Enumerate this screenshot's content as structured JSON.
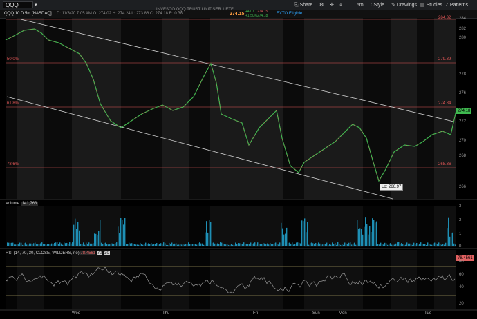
{
  "toolbar": {
    "symbol": "QQQ",
    "share": "Share",
    "interval": "5m",
    "style": "Style",
    "drawings": "Drawings",
    "studies": "Studies",
    "patterns": "Patterns"
  },
  "info": {
    "chart_id": "QQQ 10 D 5m [NASDAQ]",
    "name": "INVESCO QQQ TRUST UNIT SER 1 ETF",
    "last": "274.15",
    "change_top": "+4.07",
    "change_bottom": "+1.50%",
    "bid": "274.15",
    "ask": "274.18",
    "ext": "EXTO Eligible",
    "ohlc": "D: 11/3/20 7:05 AM   O: 274.02   H: 274.24   L: 273.86   C: 274.18   R: 0.38"
  },
  "price_panel": {
    "ylim": [
      265,
      285
    ],
    "ticks": [
      "284",
      "282",
      "280",
      "278",
      "276",
      "274",
      "272",
      "270",
      "268",
      "266"
    ],
    "fib_levels": [
      {
        "label": "50.0%",
        "value_label": "279.39"
      },
      {
        "label": "61.8%",
        "value_label": "274.84"
      },
      {
        "label": "78.6%",
        "value_label": "268.36"
      }
    ],
    "top_fib_value": "284.32",
    "last_price_badge": "274.18",
    "low_callout": "Lo: 266.97"
  },
  "volume_panel": {
    "label": "Volume",
    "value": "141,763",
    "ticks": [
      "3",
      "2",
      "1",
      "0"
    ]
  },
  "rsi_panel": {
    "label": "RSI (14, 70, 30, CLOSE, WILDERS, no)",
    "value": "78.4561",
    "overbought": "70",
    "oversold": "30",
    "ticks": [
      "80",
      "60",
      "40",
      "20"
    ]
  },
  "x_axis": [
    "Wed",
    "Thu",
    "Fri",
    "Sun",
    "Mon",
    "Tue"
  ],
  "colors": {
    "up": "#3fb950",
    "down": "#d65a5a",
    "fib": "#e05656",
    "volume": "#1e8fb5",
    "rsi": "#9a9a9a",
    "rsi_band": "#e0d080",
    "session_shade": "#2a2a2a"
  }
}
